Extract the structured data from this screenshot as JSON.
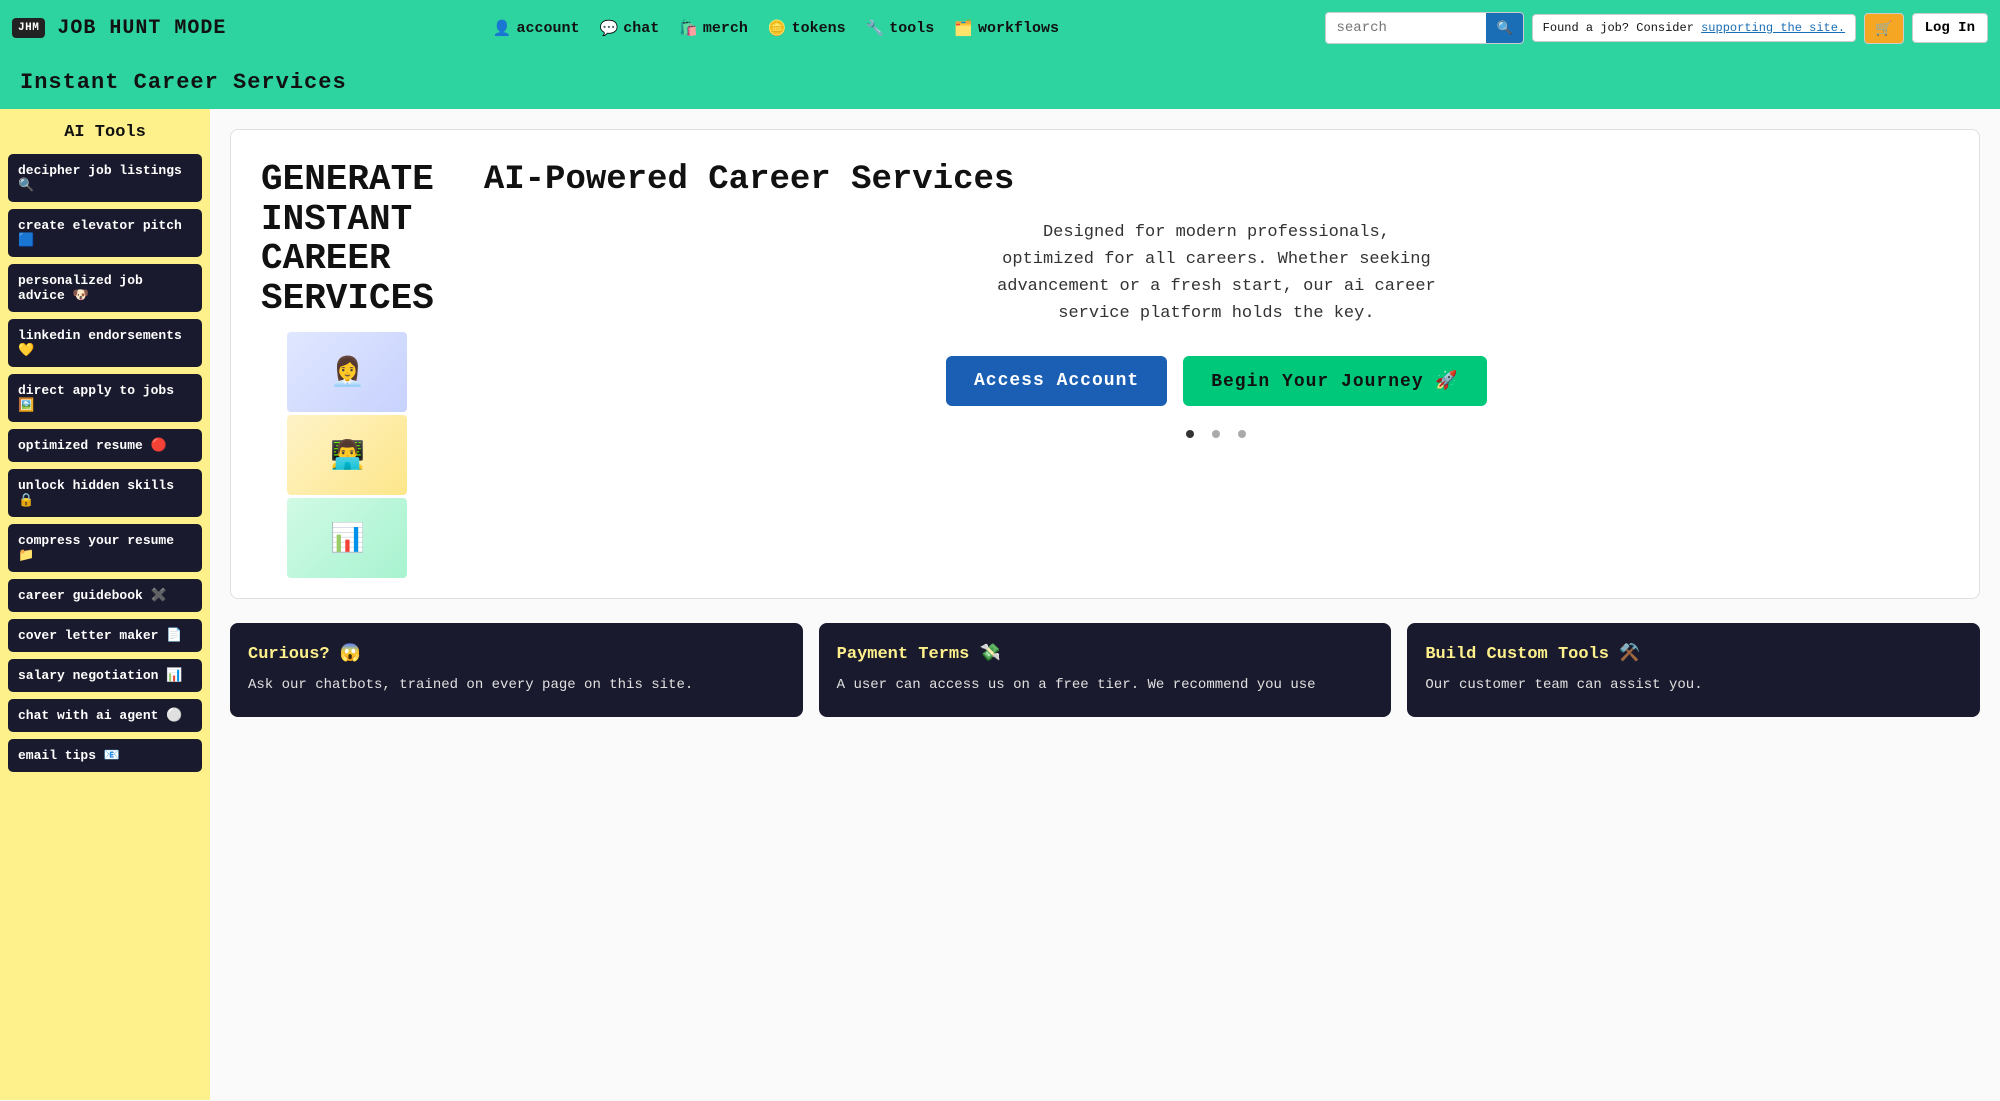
{
  "nav": {
    "logo_abbr": "JHM",
    "logo_title": "JOB HUNT MODE",
    "links": [
      {
        "label": "account",
        "icon": "👤",
        "id": "account"
      },
      {
        "label": "chat",
        "icon": "💬",
        "id": "chat"
      },
      {
        "label": "merch",
        "icon": "🛍️",
        "id": "merch"
      },
      {
        "label": "tokens",
        "icon": "🪙",
        "id": "tokens"
      },
      {
        "label": "tools",
        "icon": "🔧",
        "id": "tools"
      },
      {
        "label": "workflows",
        "icon": "🗂️",
        "id": "workflows"
      }
    ],
    "search_placeholder": "search",
    "support_prefix": "Found a job? Consider ",
    "support_link_text": "supporting the site.",
    "cart_icon": "🛒",
    "login_label": "Log In"
  },
  "page_header": {
    "title": "Instant Career Services"
  },
  "sidebar": {
    "title": "AI Tools",
    "items": [
      {
        "label": "decipher job listings 🔍",
        "id": "decipher-job-listings"
      },
      {
        "label": "create elevator pitch 🟦",
        "id": "create-elevator-pitch"
      },
      {
        "label": "personalized job advice 🐶",
        "id": "personalized-job-advice"
      },
      {
        "label": "linkedin endorsements 💛",
        "id": "linkedin-endorsements"
      },
      {
        "label": "direct apply to jobs 🖼️",
        "id": "direct-apply-to-jobs"
      },
      {
        "label": "optimized resume 🔴",
        "id": "optimized-resume"
      },
      {
        "label": "unlock hidden skills 🔒",
        "id": "unlock-hidden-skills"
      },
      {
        "label": "compress your resume 📁",
        "id": "compress-your-resume"
      },
      {
        "label": "career guidebook ✖️",
        "id": "career-guidebook"
      },
      {
        "label": "cover letter maker 📄",
        "id": "cover-letter-maker"
      },
      {
        "label": "salary negotiation 📊",
        "id": "salary-negotiation"
      },
      {
        "label": "chat with ai agent ⚪",
        "id": "chat-with-ai-agent"
      },
      {
        "label": "email tips 📧",
        "id": "email-tips"
      }
    ]
  },
  "hero": {
    "generate_text": "GENERATE\nINSTANT\nCAREER\nSERVICES",
    "title": "AI-Powered Career Services",
    "description": "Designed for modern professionals,\noptimized for all careers. Whether seeking\nadvancement or a fresh start, our ai career\nservice platform holds the key.",
    "btn_access": "Access Account",
    "btn_begin": "Begin Your Journey 🚀",
    "images": [
      "👩‍💼",
      "👨‍💻",
      "📊"
    ]
  },
  "info_cards": [
    {
      "title": "Curious? 😱",
      "body": "Ask our chatbots, trained on every page on this site.",
      "id": "curious-card"
    },
    {
      "title": "Payment Terms 💸",
      "body": "A user can access us on a free tier. We recommend you use",
      "id": "payment-terms-card"
    },
    {
      "title": "Build Custom Tools ⚒️",
      "body": "Our customer team can assist you.",
      "id": "custom-tools-card"
    }
  ]
}
